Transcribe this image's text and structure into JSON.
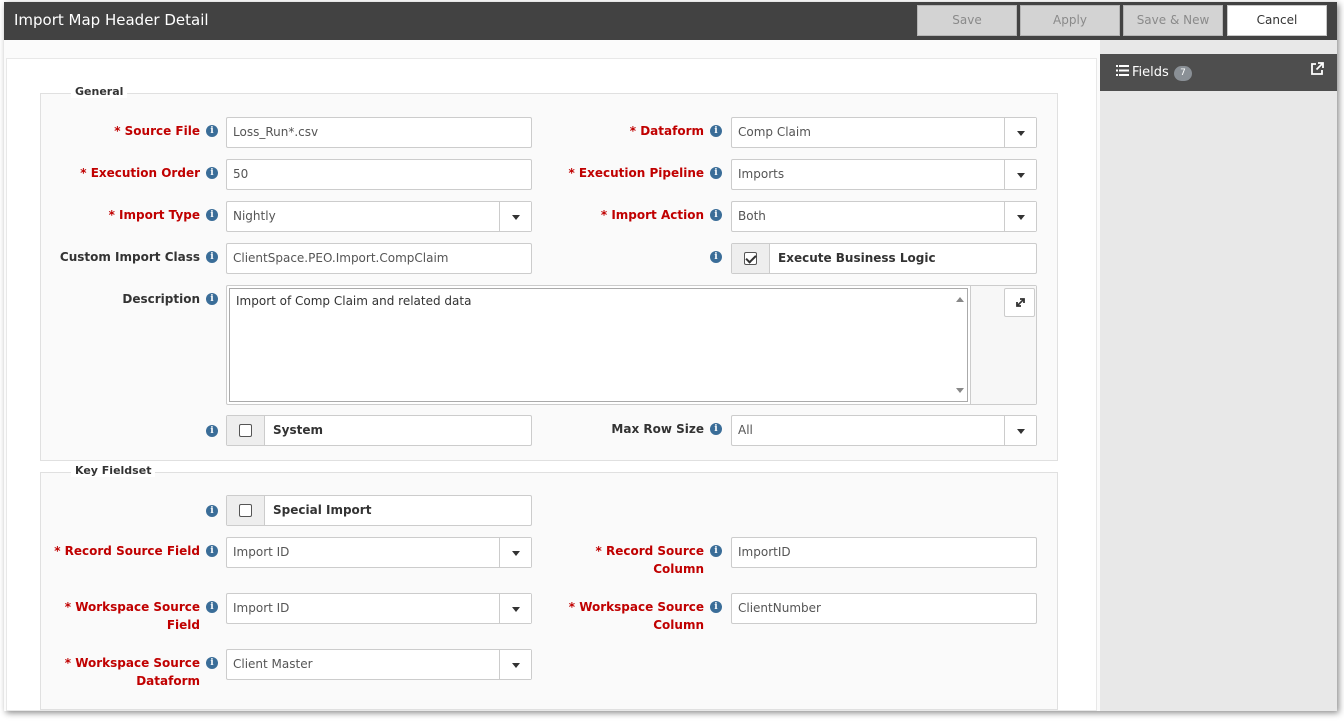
{
  "window": {
    "title": "Import Map Header Detail"
  },
  "toolbar": {
    "save": "Save",
    "apply": "Apply",
    "save_new": "Save & New",
    "cancel": "Cancel"
  },
  "side": {
    "fields_label": "Fields",
    "fields_count": "7"
  },
  "general": {
    "legend": "General",
    "source_file": {
      "label": "Source File",
      "value": "Loss_Run*.csv"
    },
    "dataform": {
      "label": "Dataform",
      "value": "Comp Claim"
    },
    "execution_order": {
      "label": "Execution Order",
      "value": "50"
    },
    "execution_pipeline": {
      "label": "Execution Pipeline",
      "value": "Imports"
    },
    "import_type": {
      "label": "Import Type",
      "value": "Nightly"
    },
    "import_action": {
      "label": "Import Action",
      "value": "Both"
    },
    "custom_import_class": {
      "label": "Custom Import Class",
      "value": "ClientSpace.PEO.Import.CompClaim"
    },
    "execute_business_logic": {
      "label": "Execute Business Logic",
      "checked": true
    },
    "description": {
      "label": "Description",
      "value": "Import of Comp Claim and related data"
    },
    "system": {
      "label": "System",
      "checked": false
    },
    "max_row_size": {
      "label": "Max Row Size",
      "value": "All"
    }
  },
  "key_fieldset": {
    "legend": "Key Fieldset",
    "special_import": {
      "label": "Special Import",
      "checked": false
    },
    "record_source_field": {
      "label": "Record Source Field",
      "value": "Import ID"
    },
    "record_source_column": {
      "label_1": "Record Source",
      "label_2": "Column",
      "value": "ImportID"
    },
    "workspace_source_field": {
      "label_1": "Workspace Source",
      "label_2": "Field",
      "value": "Import ID"
    },
    "workspace_source_column": {
      "label_1": "Workspace Source",
      "label_2": "Column",
      "value": "ClientNumber"
    },
    "workspace_source_dataform": {
      "label_1": "Workspace Source",
      "label_2": "Dataform",
      "value": "Client Master"
    }
  },
  "required_marker": "* ",
  "info_glyph": "i",
  "colors": {
    "titlebar": "#424242",
    "required": "#c00000",
    "info": "#3a6d98",
    "side_header": "#4e4e4e"
  },
  "icons": [
    "list-icon",
    "popout-icon",
    "info-icon",
    "chevron-down-icon",
    "expand-icon",
    "check-icon"
  ]
}
